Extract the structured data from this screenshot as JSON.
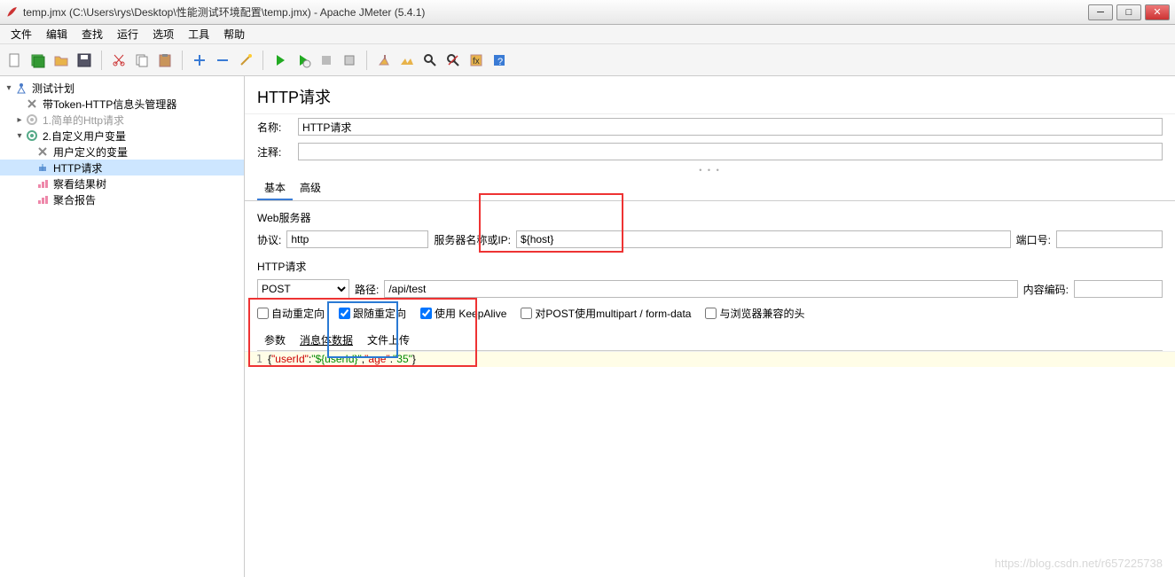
{
  "window": {
    "title": "temp.jmx (C:\\Users\\rys\\Desktop\\性能测试环境配置\\temp.jmx) - Apache JMeter (5.4.1)"
  },
  "menu": {
    "file": "文件",
    "edit": "编辑",
    "search": "查找",
    "run": "运行",
    "options": "选项",
    "tools": "工具",
    "help": "帮助"
  },
  "tree": {
    "n0": "测试计划",
    "n1": "带Token-HTTP信息头管理器",
    "n2": "1.简单的Http请求",
    "n3": "2.自定义用户变量",
    "n4": "用户定义的变量",
    "n5": "HTTP请求",
    "n6": "察看结果树",
    "n7": "聚合报告"
  },
  "panel": {
    "title": "HTTP请求",
    "name_label": "名称:",
    "name_value": "HTTP请求",
    "comment_label": "注释:",
    "comment_value": "",
    "tab_basic": "基本",
    "tab_adv": "高级",
    "web_server": "Web服务器",
    "protocol_label": "协议:",
    "protocol_value": "http",
    "server_label": "服务器名称或IP:",
    "server_value": "${host}",
    "port_label": "端口号:",
    "port_value": "",
    "http_req": "HTTP请求",
    "method_value": "POST",
    "path_label": "路径:",
    "path_value": "/api/test",
    "encoding_label": "内容编码:",
    "encoding_value": "",
    "cb_auto": "自动重定向",
    "cb_follow": "跟随重定向",
    "cb_keep": "使用 KeepAlive",
    "cb_multipart": "对POST使用multipart / form-data",
    "cb_browser": "与浏览器兼容的头",
    "bt_params": "参数",
    "bt_body": "消息体数据",
    "bt_file": "文件上传",
    "code_line_no": "1",
    "code_k1": "\"userId\"",
    "code_v1": "\"${userId}\"",
    "code_k2": "\"age\"",
    "code_v2": "\"35\""
  },
  "watermark": "https://blog.csdn.net/r657225738"
}
